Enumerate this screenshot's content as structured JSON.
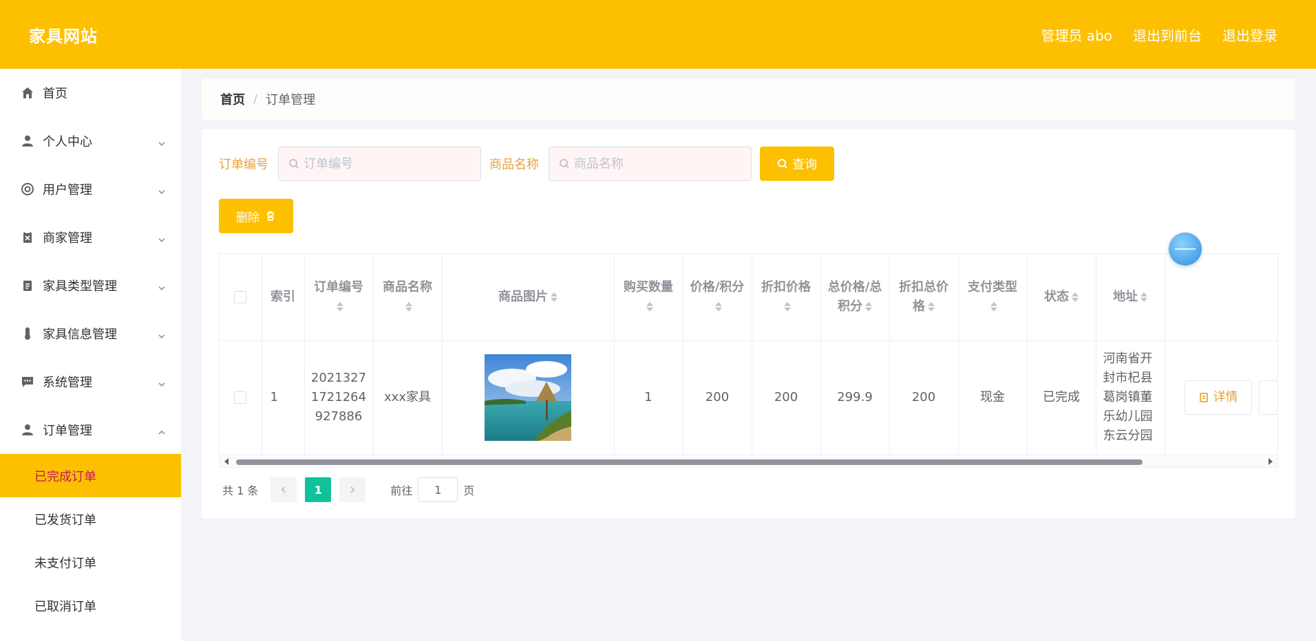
{
  "header": {
    "brand": "家具网站",
    "nav": [
      "管理员 abo",
      "退出到前台",
      "退出登录"
    ]
  },
  "sidebar": {
    "items": [
      {
        "label": "首页",
        "icon": "home-icon",
        "expandable": false
      },
      {
        "label": "个人中心",
        "icon": "user-icon",
        "expandable": true
      },
      {
        "label": "用户管理",
        "icon": "lifebuoy-icon",
        "expandable": true
      },
      {
        "label": "商家管理",
        "icon": "clipboard-x-icon",
        "expandable": true
      },
      {
        "label": "家具类型管理",
        "icon": "clipboard-icon",
        "expandable": true
      },
      {
        "label": "家具信息管理",
        "icon": "thermometer-icon",
        "expandable": true
      },
      {
        "label": "系统管理",
        "icon": "chat-icon",
        "expandable": true
      },
      {
        "label": "订单管理",
        "icon": "user-icon",
        "expandable": true,
        "expanded": true
      }
    ],
    "subitems": [
      "已完成订单",
      "已发货订单",
      "未支付订单",
      "已取消订单"
    ],
    "active_subitem": "已完成订单"
  },
  "breadcrumb": {
    "home": "首页",
    "separator": "/",
    "current": "订单管理"
  },
  "search": {
    "order_label": "订单编号",
    "order_placeholder": "订单编号",
    "product_label": "商品名称",
    "product_placeholder": "商品名称",
    "query_label": "查询"
  },
  "actions": {
    "delete_label": "删除"
  },
  "table": {
    "headers": {
      "index": "索引",
      "order_no": "订单编号",
      "product_name": "商品名称",
      "product_image": "商品图片",
      "quantity": "购买数量",
      "price": "价格/积分",
      "discount_price": "折扣价格",
      "total": "总价格/总积分",
      "discount_total": "折扣总价格",
      "pay_type": "支付类型",
      "status": "状态",
      "address": "地址"
    },
    "rows": [
      {
        "index": "1",
        "order_no": "20213271721264927886",
        "product_name": "xxx家具",
        "quantity": "1",
        "price": "200",
        "discount_price": "200",
        "total": "299.9",
        "discount_total": "200",
        "pay_type": "现金",
        "status": "已完成",
        "address": "河南省开封市杞县葛岗镇董乐幼儿园东云分园",
        "detail_label": "详情"
      }
    ]
  },
  "pagination": {
    "total_text": "共 1 条",
    "current_page": "1",
    "goto_label": "前往",
    "goto_value": "1",
    "page_suffix": "页"
  },
  "colors": {
    "accent": "#fdc000",
    "active_page": "#10c29a",
    "label": "#e6a23c"
  }
}
